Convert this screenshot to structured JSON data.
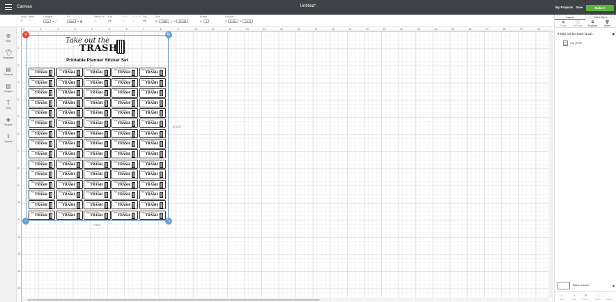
{
  "app": {
    "title": "Canvas",
    "document_title": "Untitled*"
  },
  "header": {
    "my_projects": "My Projects",
    "save": "Save",
    "make_it": "Make It"
  },
  "toolbar": {
    "undo": "Undo",
    "redo": "Redo",
    "linetype_label": "Linetype",
    "linetype_value": "Cut",
    "fill_label": "Fill",
    "fill_value": "Print",
    "select_all": "Select All",
    "edit": "Edit",
    "align": "Align",
    "arrange": "Arrange",
    "flip": "Flip",
    "size_label": "Size",
    "w_label": "W",
    "w_value": "7.855",
    "h_label": "H",
    "h_value": "10.348",
    "rotate_label": "Rotate",
    "rotate_value": "0",
    "position_label": "Position",
    "x_label": "X",
    "x_value": "0.444",
    "y_label": "Y",
    "y_value": "0.472"
  },
  "left_nav": {
    "items": [
      {
        "label": "New",
        "icon": "plus-circle-icon"
      },
      {
        "label": "Templates",
        "icon": "shirt-icon"
      },
      {
        "label": "Projects",
        "icon": "projects-icon"
      },
      {
        "label": "Images",
        "icon": "image-icon"
      },
      {
        "label": "Text",
        "icon": "text-icon"
      },
      {
        "label": "Shapes",
        "icon": "shapes-icon"
      },
      {
        "label": "Upload",
        "icon": "upload-icon"
      }
    ]
  },
  "rulers": {
    "top": [
      "0",
      "1",
      "2",
      "3",
      "4",
      "5",
      "6",
      "7",
      "8",
      "9",
      "10",
      "11",
      "12",
      "13",
      "14",
      "15",
      "16",
      "17",
      "18",
      "19",
      "20",
      "21",
      "22",
      "23",
      "24",
      "25",
      "26",
      "27",
      "28",
      "29",
      "30"
    ],
    "left": [
      "1",
      "2",
      "3",
      "4",
      "5",
      "6",
      "7",
      "8",
      "9",
      "10",
      "11",
      "12",
      "13",
      "14",
      "15"
    ]
  },
  "canvas": {
    "sheet_title_line1": "Take out the",
    "sheet_title_line2": "TRASH",
    "sheet_subtitle": "Printable Planner Sticker Set",
    "sticker_line1": "Take out the",
    "sticker_line2": "TRASH",
    "width_dim": "7.855\"",
    "height_dim": "10.348\""
  },
  "right_panel": {
    "tabs": [
      "Layers",
      "Color Sync"
    ],
    "actions": [
      "Group",
      "UnGroup",
      "Duplicate",
      "Delete"
    ],
    "layer_title": "Take out the trash functi...",
    "layer_item": "Cut  |  Print",
    "blank_canvas": "Blank Canvas",
    "bottom_actions": [
      "Slice",
      "Weld",
      "Attach",
      "Flatten",
      "Contour"
    ]
  },
  "colors": {
    "topbar": "#3e4347",
    "make_it": "#5ab43c",
    "selection": "#6a9fd0",
    "delete_handle": "#e8453c",
    "handle": "#6a9fd0"
  }
}
